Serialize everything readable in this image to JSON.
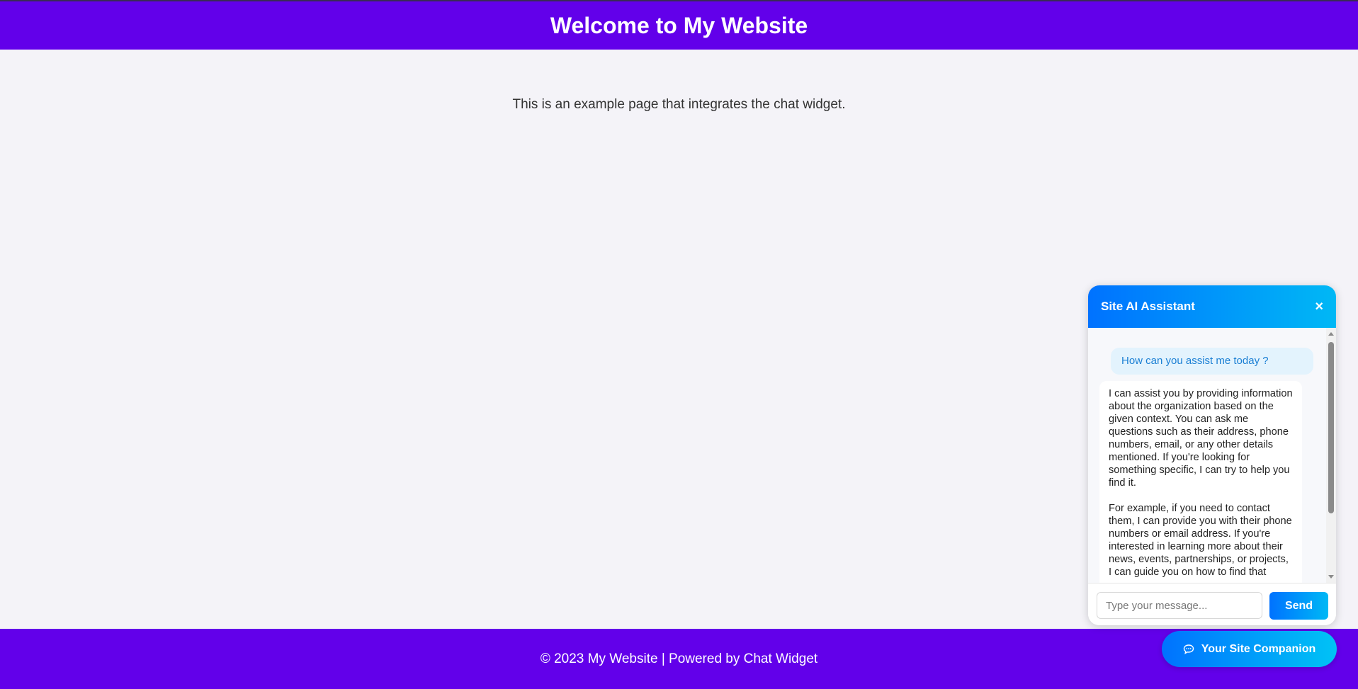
{
  "header": {
    "title": "Welcome to My Website"
  },
  "main": {
    "intro": "This is an example page that integrates the chat widget."
  },
  "footer": {
    "text": "© 2023 My Website | Powered by Chat Widget"
  },
  "chat_widget": {
    "title": "Site AI Assistant",
    "close_label": "×",
    "messages": [
      {
        "role": "user",
        "text": "How can you assist me today ?"
      },
      {
        "role": "assistant",
        "paragraphs": [
          "I can assist you by providing information about the organization based on the given context. You can ask me questions such as their address, phone numbers, email, or any other details mentioned. If you're looking for something specific, I can try to help you find it.",
          "For example, if you need to contact them, I can provide you with their phone numbers or email address. If you're interested in learning more about their news, events, partnerships, or projects, I can guide you on how to find that"
        ]
      }
    ],
    "input_placeholder": "Type your message...",
    "input_value": "",
    "send_label": "Send",
    "launcher_label": "Your Site Companion",
    "launcher_icon": "chat-bubble-icon"
  },
  "colors": {
    "brand_purple": "#6200ea",
    "accent_blue": "#0072ff",
    "accent_cyan": "#00b8f5",
    "page_bg": "#f4f3f8"
  }
}
